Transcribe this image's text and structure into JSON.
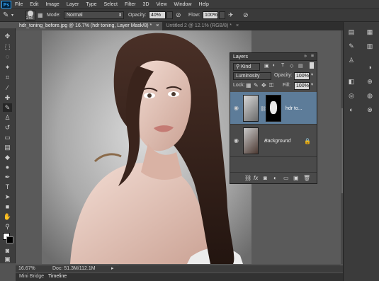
{
  "app": {
    "logo": "Ps"
  },
  "menu": [
    "File",
    "Edit",
    "Image",
    "Layer",
    "Type",
    "Select",
    "Filter",
    "3D",
    "View",
    "Window",
    "Help"
  ],
  "options": {
    "brush_size": "250",
    "mode_label": "Mode:",
    "mode_value": "Normal",
    "opacity_label": "Opacity:",
    "opacity_value": "40%",
    "flow_label": "Flow:",
    "flow_value": "100%"
  },
  "tabs": [
    {
      "label": "hdr_toning_before.jpg @ 16.7% (hdr toning, Layer Mask/8) *",
      "active": true
    },
    {
      "label": "Untitled 2 @ 12.1% (RGB/8) *",
      "active": false
    }
  ],
  "layers_panel": {
    "title": "Layers",
    "kind_label": "Kind",
    "blend_mode": "Luminosity",
    "opacity_label": "Opacity:",
    "opacity_value": "100%",
    "lock_label": "Lock:",
    "fill_label": "Fill:",
    "fill_value": "100%",
    "layers": [
      {
        "name": "hdr to...",
        "selected": true
      },
      {
        "name": "Background",
        "selected": false
      }
    ]
  },
  "status": {
    "zoom": "16.67%",
    "doc": "Doc: 51.3M/112.1M"
  },
  "bottom_tabs": [
    "Mini Bridge",
    "Timeline"
  ],
  "colors": {
    "accent": "#5d7c99",
    "panel": "#4a4a4a",
    "menubar": "#3c3c3c"
  }
}
